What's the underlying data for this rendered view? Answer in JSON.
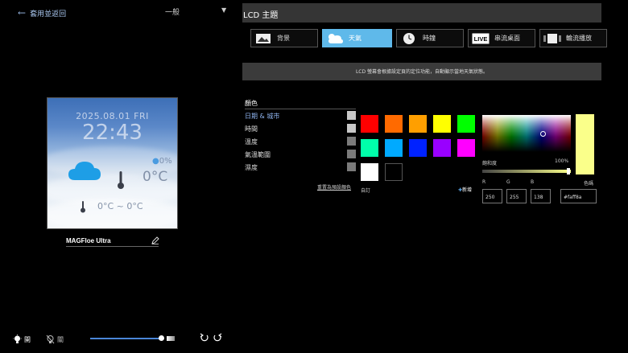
{
  "left": {
    "apply_back_label": "套用並返回",
    "mode_value": "一般",
    "device_name": "MAGFloe Ultra",
    "preview": {
      "date": "2025.08.01 FRI",
      "time": "22:43",
      "humidity": "0%",
      "temperature": "0°C",
      "range": "0°C ~ 0°C"
    },
    "bottom": {
      "light_on_label": "開",
      "light_off_label": "關",
      "brightness_level": 0.95
    }
  },
  "right": {
    "title": "LCD 主題",
    "tabs": [
      {
        "label": "背景",
        "icon": "image-icon",
        "active": false
      },
      {
        "label": "天氣",
        "icon": "weather-icon",
        "active": true
      },
      {
        "label": "時鐘",
        "icon": "clock-icon",
        "active": false
      },
      {
        "label": "串流桌面",
        "icon": "live-icon",
        "active": false
      },
      {
        "label": "輪流播放",
        "icon": "slideshow-icon",
        "active": false
      }
    ],
    "info": "LCD 螢幕會根據設定頁的定位功能，自動顯示當地天氣狀態。",
    "color_section": {
      "header": "顏色",
      "items": [
        {
          "label": "日期 & 城市",
          "swatch": "#c8c8c8",
          "selected": true
        },
        {
          "label": "時間",
          "swatch": "#c8c8c8",
          "selected": false
        },
        {
          "label": "溫度",
          "swatch": "#7a7a7a",
          "selected": false
        },
        {
          "label": "氣溫範圍",
          "swatch": "#7a7a7a",
          "selected": false
        },
        {
          "label": "濕度",
          "swatch": "#7a7a7a",
          "selected": false
        }
      ],
      "reset_label": "重置為預設顏色"
    },
    "palette": [
      "#ff0000",
      "#ff6a00",
      "#ff9f00",
      "#ffff00",
      "#00ff00",
      "#00ffaa",
      "#00aaff",
      "#0022ff",
      "#9900ff",
      "#ff00ff",
      "#ffffff",
      "#000000"
    ],
    "custom_label": "自訂",
    "add_label": "新增",
    "picker": {
      "saturation_label": "飽和度",
      "saturation_value": "100%",
      "preview_label": "色碼",
      "preview_color": "#faff8a",
      "r_label": "R",
      "g_label": "G",
      "b_label": "B",
      "r": "250",
      "g": "255",
      "b": "138",
      "hex": "#faff8a"
    }
  }
}
